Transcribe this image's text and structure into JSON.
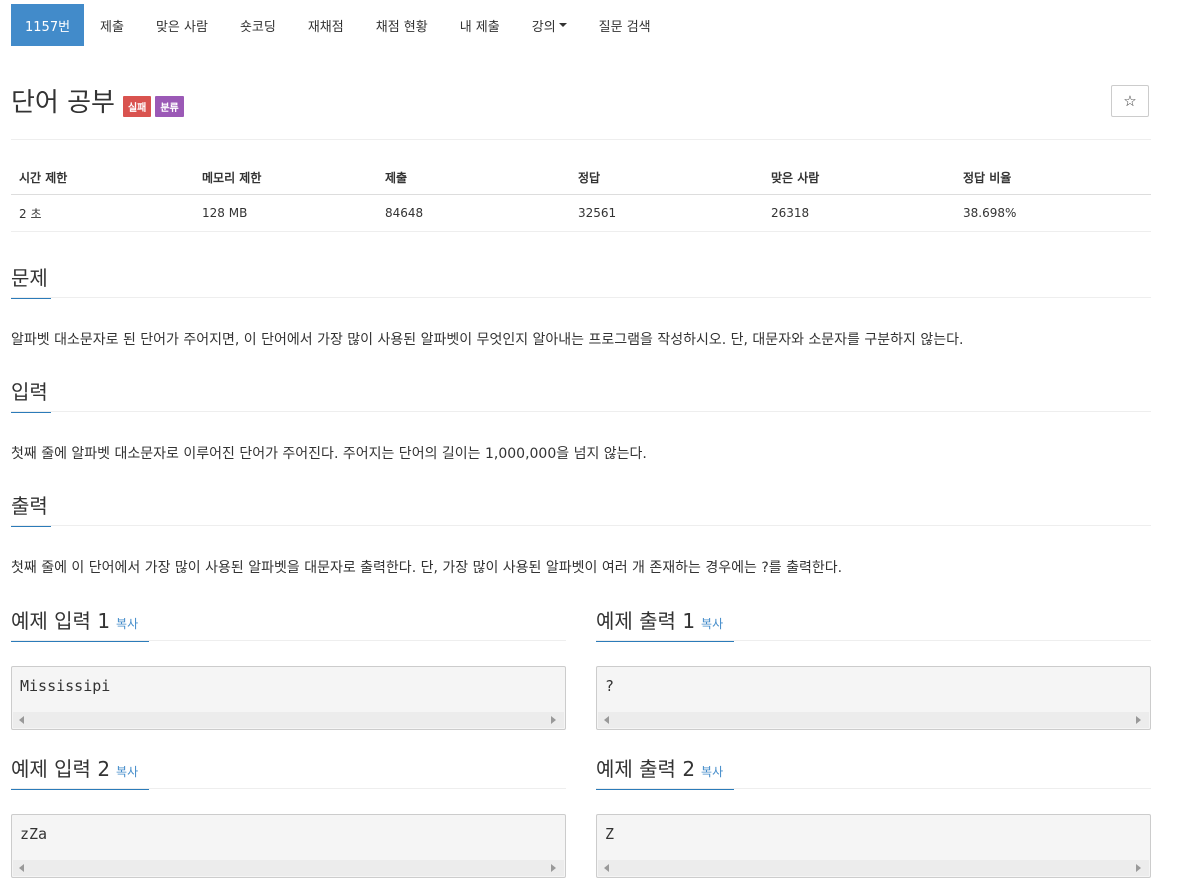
{
  "nav": {
    "items": [
      "1157번",
      "제출",
      "맞은 사람",
      "숏코딩",
      "재채점",
      "채점 현황",
      "내 제출",
      "강의",
      "질문 검색"
    ]
  },
  "problem": {
    "title": "단어 공부",
    "badges": [
      "실패",
      "분류"
    ],
    "star": "☆"
  },
  "stats": {
    "headers": [
      "시간 제한",
      "메모리 제한",
      "제출",
      "정답",
      "맞은 사람",
      "정답 비율"
    ],
    "values": [
      "2 초",
      "128 MB",
      "84648",
      "32561",
      "26318",
      "38.698%"
    ]
  },
  "sections": {
    "problem": {
      "heading": "문제",
      "text": "알파벳 대소문자로 된 단어가 주어지면, 이 단어에서 가장 많이 사용된 알파벳이 무엇인지 알아내는 프로그램을 작성하시오. 단, 대문자와 소문자를 구분하지 않는다."
    },
    "input": {
      "heading": "입력",
      "text": "첫째 줄에 알파벳 대소문자로 이루어진 단어가 주어진다. 주어지는 단어의 길이는 1,000,000을 넘지 않는다."
    },
    "output": {
      "heading": "출력",
      "text": "첫째 줄에 이 단어에서 가장 많이 사용된 알파벳을 대문자로 출력한다. 단, 가장 많이 사용된 알파벳이 여러 개 존재하는 경우에는 ?를 출력한다."
    }
  },
  "samples": {
    "copy_label": "복사",
    "in1": {
      "heading": "예제 입력 1",
      "content": "Mississipi"
    },
    "out1": {
      "heading": "예제 출력 1",
      "content": "?"
    },
    "in2": {
      "heading": "예제 입력 2",
      "content": "zZa"
    },
    "out2": {
      "heading": "예제 출력 2",
      "content": "Z"
    }
  },
  "colors": {
    "nav_active": "#428bca",
    "badge_fail": "#d9534f",
    "badge_category": "#9b59b6",
    "section_underline": "#2b7bb9",
    "link": "#428bca"
  }
}
